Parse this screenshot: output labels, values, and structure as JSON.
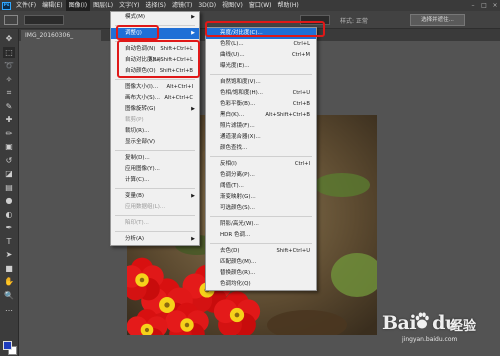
{
  "app": {
    "logo": "Ps"
  },
  "menubar": {
    "items": [
      "文件(F)",
      "编辑(E)",
      "图像(I)",
      "图层(L)",
      "文字(Y)",
      "选择(S)",
      "滤镜(T)",
      "3D(D)",
      "视图(V)",
      "窗口(W)",
      "帮助(H)"
    ],
    "active_index": 2
  },
  "options_bar": {
    "style_label": "样式: 正常",
    "select_mask_button": "选择并遮住..."
  },
  "document": {
    "tab_title": "IMG_20160306_"
  },
  "toolbar": {
    "tools": [
      "move-icon",
      "marquee-icon",
      "lasso-icon",
      "quick-select-icon",
      "crop-icon",
      "eyedropper-icon",
      "healing-icon",
      "brush-icon",
      "stamp-icon",
      "history-brush-icon",
      "eraser-icon",
      "gradient-icon",
      "blur-icon",
      "dodge-icon",
      "pen-icon",
      "type-icon",
      "path-select-icon",
      "shape-icon",
      "hand-icon",
      "zoom-icon",
      "more-icon"
    ],
    "foreground_color": "#1e3cbe",
    "background_color": "#ffffff"
  },
  "image_menu": {
    "items": [
      {
        "label": "模式(M)",
        "shortcut": "",
        "submenu": true,
        "disabled": false
      },
      {
        "sep": true
      },
      {
        "label": "调整(J)",
        "shortcut": "",
        "submenu": true,
        "disabled": false,
        "highlight": true
      },
      {
        "sep": true
      },
      {
        "label": "自动色调(N)",
        "shortcut": "Shift+Ctrl+L"
      },
      {
        "label": "自动对比度(U)",
        "shortcut": "Alt+Shift+Ctrl+L"
      },
      {
        "label": "自动颜色(O)",
        "shortcut": "Shift+Ctrl+B"
      },
      {
        "sep": true
      },
      {
        "label": "图像大小(I)...",
        "shortcut": "Alt+Ctrl+I"
      },
      {
        "label": "画布大小(S)...",
        "shortcut": "Alt+Ctrl+C"
      },
      {
        "label": "图像旋转(G)",
        "shortcut": "",
        "submenu": true
      },
      {
        "label": "裁剪(P)",
        "shortcut": "",
        "disabled": true
      },
      {
        "label": "裁切(R)...",
        "shortcut": ""
      },
      {
        "label": "显示全部(V)",
        "shortcut": ""
      },
      {
        "sep": true
      },
      {
        "label": "复制(D)...",
        "shortcut": ""
      },
      {
        "label": "应用图像(Y)...",
        "shortcut": ""
      },
      {
        "label": "计算(C)...",
        "shortcut": ""
      },
      {
        "sep": true
      },
      {
        "label": "变量(B)",
        "shortcut": "",
        "submenu": true
      },
      {
        "label": "应用数据组(L)...",
        "shortcut": "",
        "disabled": true
      },
      {
        "sep": true
      },
      {
        "label": "陷印(T)...",
        "shortcut": "",
        "disabled": true
      },
      {
        "sep": true
      },
      {
        "label": "分析(A)",
        "shortcut": "",
        "submenu": true
      }
    ]
  },
  "adjust_submenu": {
    "items": [
      {
        "label": "亮度/对比度(C)...",
        "shortcut": "",
        "highlight": true
      },
      {
        "label": "色阶(L)...",
        "shortcut": "Ctrl+L"
      },
      {
        "label": "曲线(U)...",
        "shortcut": "Ctrl+M"
      },
      {
        "label": "曝光度(E)...",
        "shortcut": ""
      },
      {
        "sep": true
      },
      {
        "label": "自然饱和度(V)...",
        "shortcut": ""
      },
      {
        "label": "色相/饱和度(H)...",
        "shortcut": "Ctrl+U"
      },
      {
        "label": "色彩平衡(B)...",
        "shortcut": "Ctrl+B"
      },
      {
        "label": "黑白(K)...",
        "shortcut": "Alt+Shift+Ctrl+B"
      },
      {
        "label": "照片滤镜(F)...",
        "shortcut": ""
      },
      {
        "label": "通道混合器(X)...",
        "shortcut": ""
      },
      {
        "label": "颜色查找...",
        "shortcut": ""
      },
      {
        "sep": true
      },
      {
        "label": "反相(I)",
        "shortcut": "Ctrl+I"
      },
      {
        "label": "色调分离(P)...",
        "shortcut": ""
      },
      {
        "label": "阈值(T)...",
        "shortcut": ""
      },
      {
        "label": "渐变映射(G)...",
        "shortcut": ""
      },
      {
        "label": "可选颜色(S)...",
        "shortcut": ""
      },
      {
        "sep": true
      },
      {
        "label": "阴影/高光(W)...",
        "shortcut": ""
      },
      {
        "label": "HDR 色调...",
        "shortcut": ""
      },
      {
        "sep": true
      },
      {
        "label": "去色(D)",
        "shortcut": "Shift+Ctrl+U"
      },
      {
        "label": "匹配颜色(M)...",
        "shortcut": ""
      },
      {
        "label": "替换颜色(R)...",
        "shortcut": ""
      },
      {
        "label": "色调均化(Q)",
        "shortcut": ""
      }
    ]
  },
  "watermark": {
    "brand": "Bai",
    "brand2": "du",
    "suffix": "经验",
    "url": "jingyan.baidu.com"
  },
  "colors": {
    "highlight": "#1f6fd6",
    "annotation_red": "#e01818",
    "menu_bg": "#f0f0f0"
  }
}
